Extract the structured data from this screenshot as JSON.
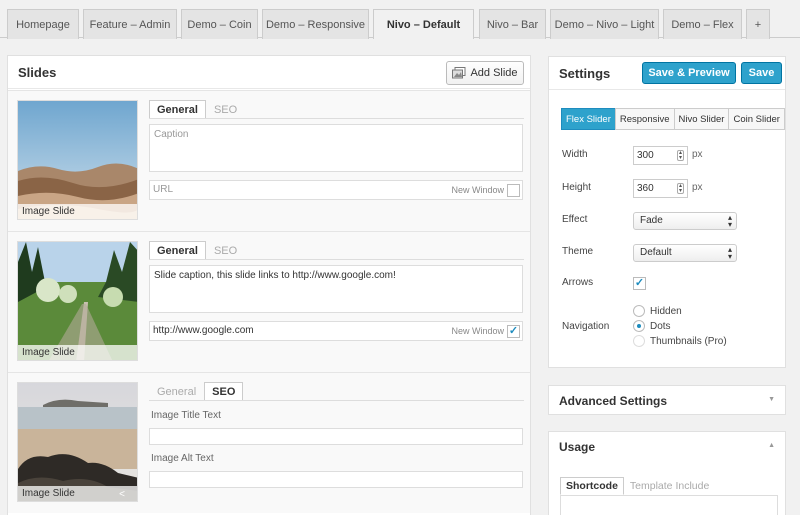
{
  "tabs": [
    "Homepage",
    "Feature – Admin",
    "Demo – Coin",
    "Demo – Responsive",
    "Nivo – Default",
    "Nivo – Bar",
    "Demo – Nivo – Light",
    "Demo – Flex",
    "+"
  ],
  "slides_panel": {
    "title": "Slides",
    "add_button": "Add Slide",
    "slides": [
      {
        "thumb_label": "Image Slide",
        "tabs": [
          "General",
          "SEO"
        ],
        "active_tab": "General",
        "caption_placeholder": "Caption",
        "caption": "",
        "url_placeholder": "URL",
        "url": "",
        "new_window_label": "New Window",
        "new_window_checked": false
      },
      {
        "thumb_label": "Image Slide",
        "tabs": [
          "General",
          "SEO"
        ],
        "active_tab": "General",
        "caption": "Slide caption, this slide links to http://www.google.com!",
        "url": "http://www.google.com",
        "new_window_label": "New Window",
        "new_window_checked": true
      },
      {
        "thumb_label": "Image Slide",
        "tabs": [
          "General",
          "SEO"
        ],
        "active_tab": "SEO",
        "title_text_label": "Image Title Text",
        "alt_text_label": "Image Alt Text"
      }
    ]
  },
  "settings": {
    "title": "Settings",
    "save_preview": "Save & Preview",
    "save": "Save",
    "slider_types": [
      "Flex Slider",
      "Responsive",
      "Nivo Slider",
      "Coin Slider"
    ],
    "active_type": "Flex Slider",
    "width_label": "Width",
    "width": "300",
    "height_label": "Height",
    "height": "360",
    "unit": "px",
    "effect_label": "Effect",
    "effect": "Fade",
    "theme_label": "Theme",
    "theme": "Default",
    "arrows_label": "Arrows",
    "arrows_checked": true,
    "navigation_label": "Navigation",
    "navigation_options": [
      "Hidden",
      "Dots",
      "Thumbnails (Pro)"
    ],
    "navigation_selected": "Dots"
  },
  "advanced": {
    "title": "Advanced Settings"
  },
  "usage": {
    "title": "Usage",
    "tabs": [
      "Shortcode",
      "Template Include"
    ],
    "active_tab": "Shortcode"
  },
  "colors": {
    "accent": "#2ea2cc",
    "accent_border": "#0074a2"
  }
}
